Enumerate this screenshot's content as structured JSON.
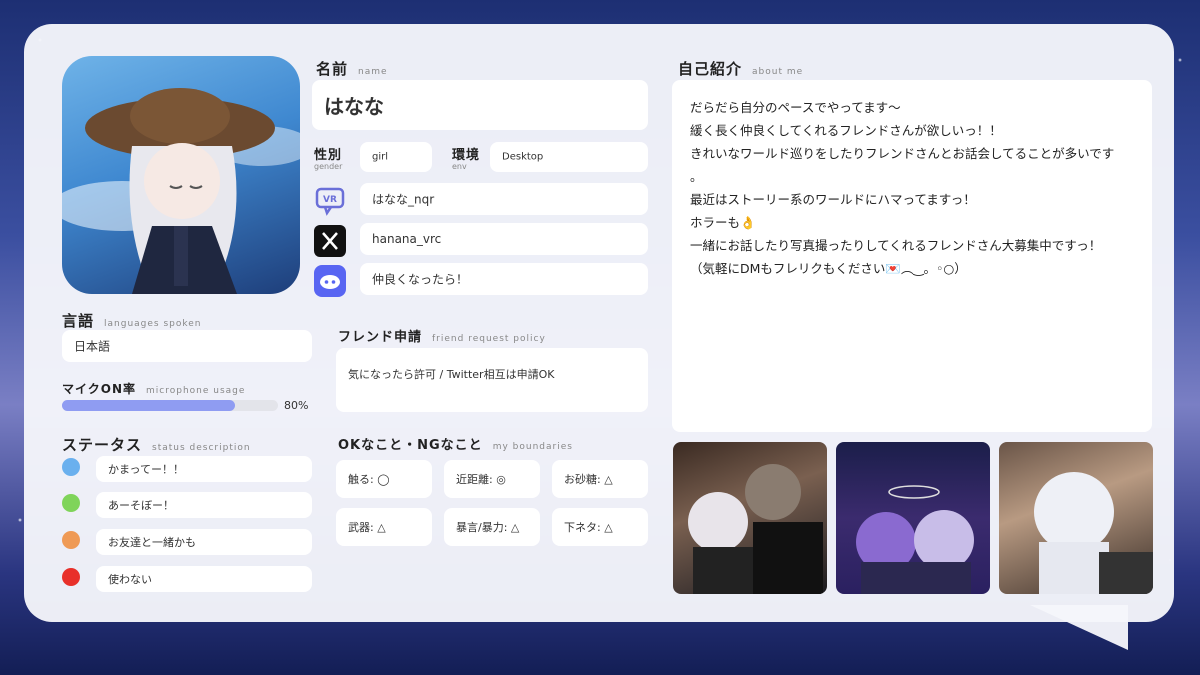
{
  "name_section": {
    "title": "名前",
    "sub": "name",
    "value": "はなな"
  },
  "gender": {
    "title": "性別",
    "sub": "gender",
    "value": "girl"
  },
  "env": {
    "title": "環境",
    "sub": "env",
    "value": "Desktop"
  },
  "vrchat": {
    "value": "はなな_nqr",
    "icon": "vr-logo-icon"
  },
  "twitter": {
    "value": "hanana_vrc",
    "icon": "x-logo-icon"
  },
  "discord": {
    "value": "仲良くなったら！",
    "icon": "discord-icon"
  },
  "language": {
    "title": "言語",
    "sub": "languages spoken",
    "value": "日本語"
  },
  "mic": {
    "title": "マイクON率",
    "sub": "microphone usage",
    "percent": 80,
    "label": "80%",
    "color": "#8f9cf2"
  },
  "status": {
    "title": "ステータス",
    "sub": "status description",
    "items": [
      {
        "color": "#6ab0ee",
        "text": "かまってー！！"
      },
      {
        "color": "#7fd45a",
        "text": "あーそぼー！"
      },
      {
        "color": "#ef9a55",
        "text": "お友達と一緒かも"
      },
      {
        "color": "#e8302a",
        "text": "使わない"
      }
    ]
  },
  "friend": {
    "title": "フレンド申請",
    "sub": "friend request policy",
    "value": "気になったら許可 / Twitter相互は申請OK"
  },
  "boundaries": {
    "title": "OKなこと・NGなこと",
    "sub": "my boundaries",
    "items": [
      "触る: ◯",
      "近距離: ◎",
      "お砂糖: △",
      "武器: △",
      "暴言/暴力: △",
      "下ネタ: △"
    ]
  },
  "about": {
    "title": "自己紹介",
    "sub": "about me",
    "lines": [
      "だらだら自分のペースでやってます〜",
      "緩く長く仲良くしてくれるフレンドさんが欲しいっ！！",
      "きれいなワールド巡りをしたりフレンドさんとお話会してることが多いです",
      "。",
      "最近はストーリー系のワールドにハマってますっ！",
      "ホラーも👌",
      "一緒にお話したり写真撮ったりしてくれるフレンドさん大募集中ですっ！",
      "（気軽にDMもフレリクもください💌︵‿。◦○）"
    ]
  }
}
